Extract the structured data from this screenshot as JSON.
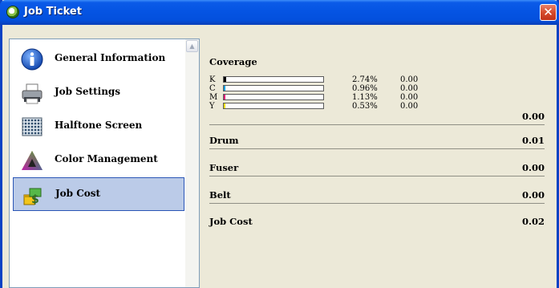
{
  "window": {
    "title": "Job Ticket",
    "close_glyph": "✕"
  },
  "sidebar": {
    "items": [
      {
        "label": "General Information",
        "icon": "info-icon",
        "selected": false
      },
      {
        "label": "Job Settings",
        "icon": "printer-icon",
        "selected": false
      },
      {
        "label": "Halftone Screen",
        "icon": "halftone-icon",
        "selected": false
      },
      {
        "label": "Color Management",
        "icon": "color-triangle-icon",
        "selected": false
      },
      {
        "label": "Job Cost",
        "icon": "money-icon",
        "selected": true
      }
    ]
  },
  "coverage": {
    "title": "Coverage",
    "total": "0.00",
    "rows": [
      {
        "channel": "K",
        "percent": "2.74%",
        "cost": "0.00",
        "fill": 0.0274,
        "color": "#000000"
      },
      {
        "channel": "C",
        "percent": "0.96%",
        "cost": "0.00",
        "fill": 0.0096,
        "color": "#00a0e0"
      },
      {
        "channel": "M",
        "percent": "1.13%",
        "cost": "0.00",
        "fill": 0.0113,
        "color": "#e0207a"
      },
      {
        "channel": "Y",
        "percent": "0.53%",
        "cost": "0.00",
        "fill": 0.0053,
        "color": "#f0e000"
      }
    ]
  },
  "drum": {
    "label": "Drum",
    "value": "0.01"
  },
  "fuser": {
    "label": "Fuser",
    "value": "0.00"
  },
  "belt": {
    "label": "Belt",
    "value": "0.00"
  },
  "job_cost": {
    "label": "Job Cost",
    "value": "0.02"
  }
}
